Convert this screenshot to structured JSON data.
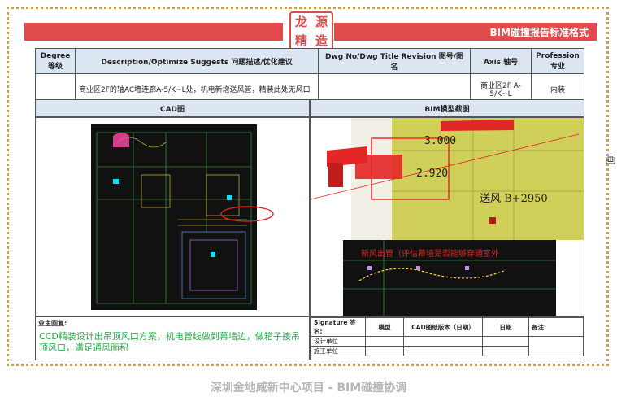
{
  "header": {
    "logo_chars": [
      "龙",
      "源",
      "精",
      "造"
    ],
    "title": "BIM碰撞报告标准格式"
  },
  "table": {
    "headers": {
      "degree": "Degree 等级",
      "description": "Description/Optimize Suggests 问题描述/优化建议",
      "dwg": "Dwg No/Dwg Title Revision 图号/图名",
      "axis": "Axis 轴号",
      "profession": "Profession 专业"
    },
    "row": {
      "degree": "",
      "description": "商业区2F的轴AC墙连廊A-5/K~L处，机电新增送风管，精装此处无风口",
      "dwg": "",
      "axis": "商业区2F A-5/K~L",
      "profession": "内装"
    }
  },
  "sections": {
    "cad_title": "CAD图",
    "bim_title": "BIM模型截图"
  },
  "bim_annotations": {
    "elev1": "3.000",
    "elev2": "2.920",
    "air_label": "送风 B+2950",
    "cad_note": "新风出管（评估幕墙是否能够穿通室外"
  },
  "bottom": {
    "owner_label": "业主回复:",
    "owner_reply": "CCD精装设计出吊顶风口方案，机电管线做到幕墙边，做箱子接吊顶风口，满足通风面积",
    "sig_headers": [
      "Signature 签名:",
      "模型",
      "CAD图纸版本（日期）",
      "日期",
      "备注:"
    ],
    "sig_rows": [
      "设计单位",
      "施工单位"
    ]
  },
  "footer": "深圳金地威新中心项目 - BIM碰撞协调",
  "side_glyph": "画",
  "colors": {
    "accent_red": "#e24b4b",
    "header_blue": "#dce6f2",
    "reply_green": "#2aa84a",
    "border_gold": "#c8a24a"
  }
}
